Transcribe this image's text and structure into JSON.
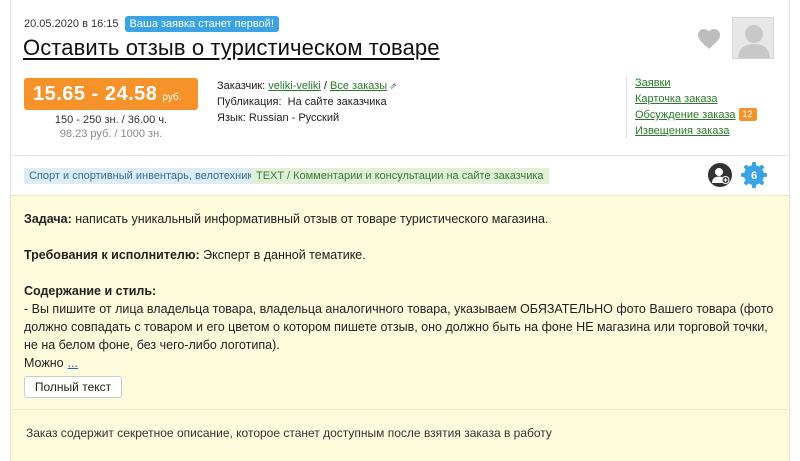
{
  "order": {
    "date": "20.05.2020 в 16:15",
    "first_badge": "Ваша заявка станет первой!",
    "title": "Оставить отзыв о туристическом товаре"
  },
  "price": {
    "range": "15.65 - 24.58",
    "unit": "руб.",
    "volume": "150 - 250 зн. / 36.00 ч.",
    "rate": "98.23 руб. / 1000 зн."
  },
  "info": {
    "customer_label": "Заказчик:",
    "customer_name": "veliki-veliki",
    "divider": "/",
    "all_orders": "Все заказы",
    "publication_label": "Публикация:",
    "publication_value": "На сайте заказчика",
    "language_label": "Язык:",
    "language_value": "Russian - Русский"
  },
  "links": {
    "applications": "Заявки",
    "order_card": "Карточка заказа",
    "discussion": "Обсуждение заказа",
    "discussion_count": "12",
    "notification": "Извещения заказа"
  },
  "tags": {
    "category": "Спорт и спортивный инвентарь, велотехника",
    "type": "TEXT / Комментарии и консультации на сайте заказчика"
  },
  "gear_count": "6",
  "task": {
    "task_label": "Задача:",
    "task_text": " написать уникальный информативный отзыв от товаре туристического магазина.",
    "req_label": "Требования к исполнителю:",
    "req_text": " Эксперт в данной тематике.",
    "style_label": "Содержание и стиль:",
    "style_text": "- Вы пишите от лица владельца товара, владельца аналогичного товара, указываем ОБЯЗАТЕЛЬНО фото Вашего товара (фото должно совпадать с товаром и его цветом о котором пишете отзыв, оно должно быть на фоне НЕ магазина или торговой точки, не на белом фоне, без чего-либо логотипа).",
    "more_prefix": "Можно",
    "more_link": "...",
    "full_text_button": "Полный текст"
  },
  "secret_notice": "Заказ содержит секретное описание, которое станет доступным после взятия заказа в работу",
  "colors": {
    "price_bg": "#f5922a",
    "badge_blue": "#3aa3e3",
    "link_green": "#2a7a2a",
    "task_bg": "#fcfbdc"
  },
  "icons": [
    "heart-icon",
    "avatar-placeholder",
    "external-link-icon",
    "user-add-icon",
    "gear-icon"
  ]
}
